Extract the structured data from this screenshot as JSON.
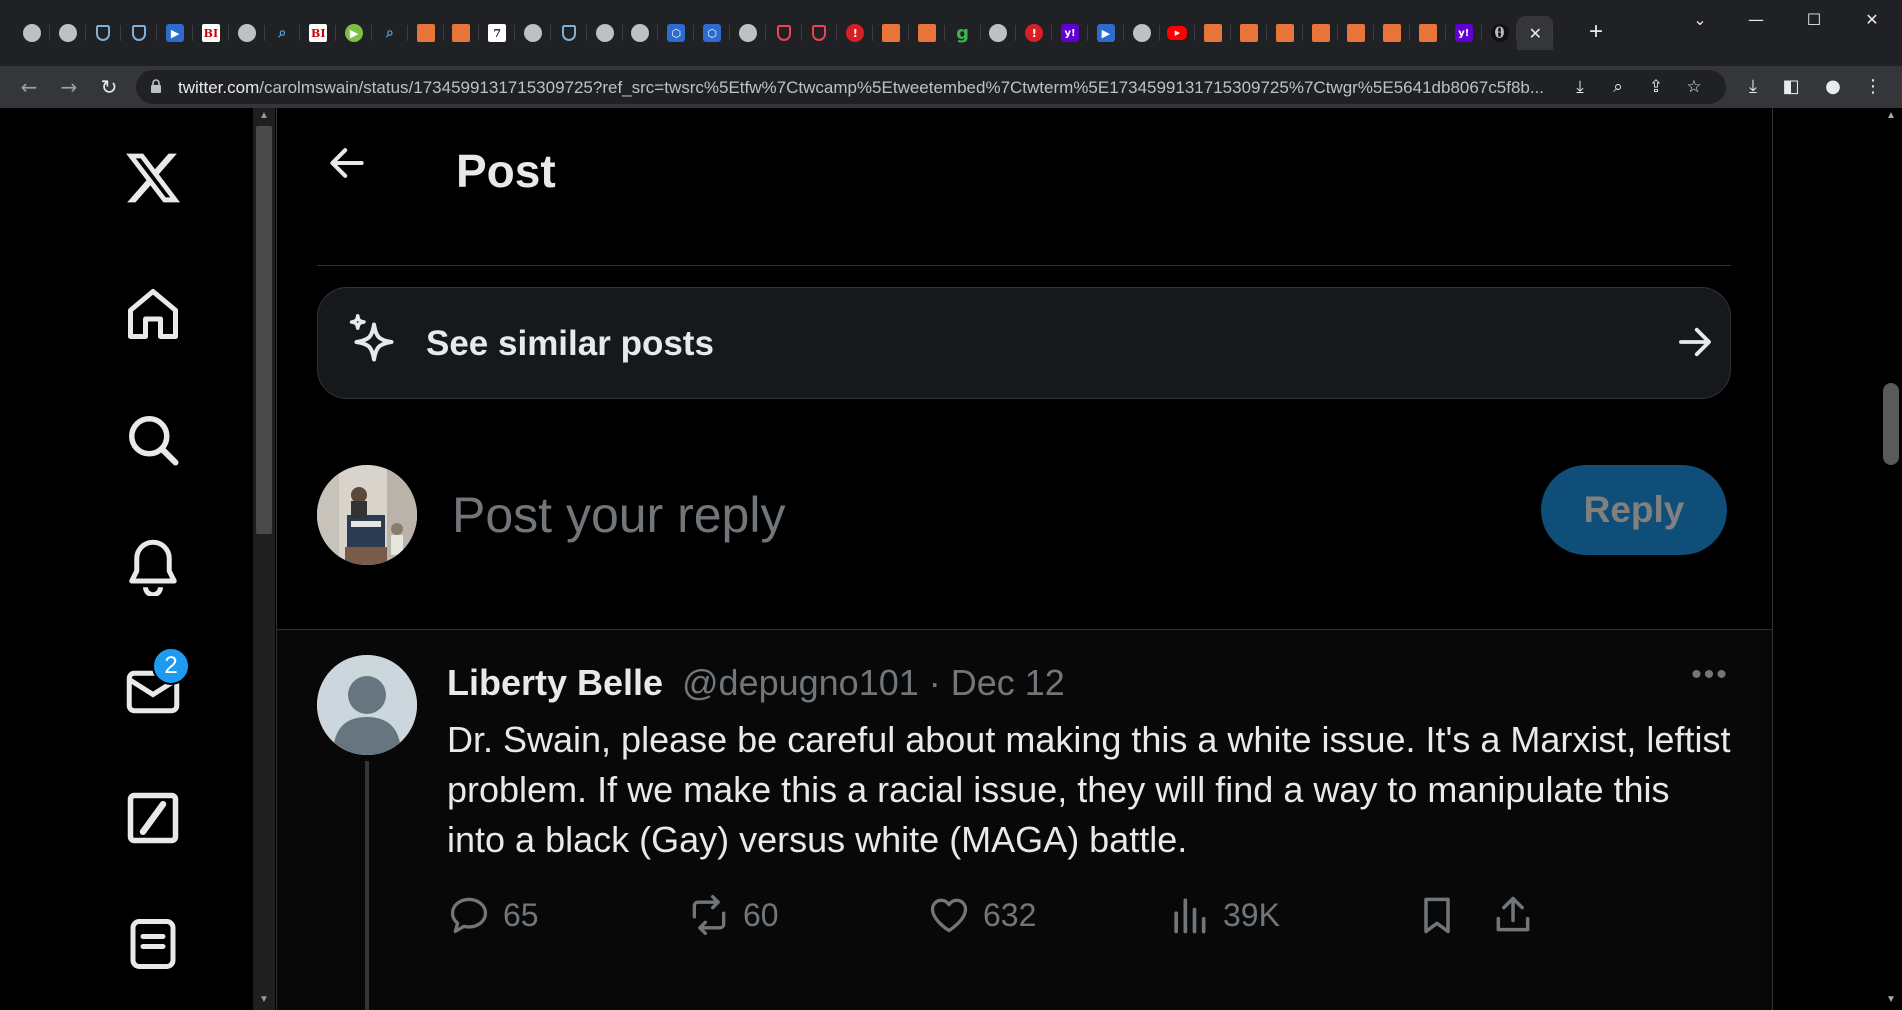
{
  "browser": {
    "tabs": [
      {
        "icon": "globe-favicon",
        "glyph": ""
      },
      {
        "icon": "globe-favicon",
        "glyph": ""
      },
      {
        "icon": "shield-favicon",
        "glyph": ""
      },
      {
        "icon": "shield-favicon",
        "glyph": ""
      },
      {
        "icon": "tag-favicon",
        "glyph": "▶"
      },
      {
        "icon": "bi-favicon",
        "glyph": "BI"
      },
      {
        "icon": "globe-favicon",
        "glyph": ""
      },
      {
        "icon": "search-favicon",
        "glyph": "⌕"
      },
      {
        "icon": "bi-favicon",
        "glyph": "BI"
      },
      {
        "icon": "play-favicon",
        "glyph": "▶"
      },
      {
        "icon": "search-favicon",
        "glyph": "⌕"
      },
      {
        "icon": "bookmark-favicon",
        "glyph": ""
      },
      {
        "icon": "bookmark-favicon",
        "glyph": ""
      },
      {
        "icon": "paper-favicon",
        "glyph": "7"
      },
      {
        "icon": "globe-favicon",
        "glyph": ""
      },
      {
        "icon": "shield-favicon",
        "glyph": ""
      },
      {
        "icon": "globe-favicon",
        "glyph": ""
      },
      {
        "icon": "globe-favicon",
        "glyph": ""
      },
      {
        "icon": "hex-favicon",
        "glyph": "⬡"
      },
      {
        "icon": "hex-favicon",
        "glyph": "⬡"
      },
      {
        "icon": "globe-favicon",
        "glyph": ""
      },
      {
        "icon": "pocket-favicon",
        "glyph": ""
      },
      {
        "icon": "pocket-favicon",
        "glyph": ""
      },
      {
        "icon": "red-favicon",
        "glyph": "!"
      },
      {
        "icon": "bookmark-favicon",
        "glyph": ""
      },
      {
        "icon": "bookmark-favicon",
        "glyph": ""
      },
      {
        "icon": "green-g-favicon",
        "glyph": "g"
      },
      {
        "icon": "globe-favicon",
        "glyph": ""
      },
      {
        "icon": "red-favicon",
        "glyph": "!"
      },
      {
        "icon": "yahoo-favicon",
        "glyph": "y!"
      },
      {
        "icon": "tag-favicon",
        "glyph": "▶"
      },
      {
        "icon": "globe-favicon",
        "glyph": ""
      },
      {
        "icon": "youtube-favicon",
        "glyph": "▶"
      },
      {
        "icon": "bookmark-favicon",
        "glyph": ""
      },
      {
        "icon": "bookmark-favicon",
        "glyph": ""
      },
      {
        "icon": "bookmark-favicon",
        "glyph": ""
      },
      {
        "icon": "bookmark-favicon",
        "glyph": ""
      },
      {
        "icon": "bookmark-favicon",
        "glyph": ""
      },
      {
        "icon": "bookmark-favicon",
        "glyph": ""
      },
      {
        "icon": "bookmark-favicon",
        "glyph": ""
      },
      {
        "icon": "yahoo-favicon",
        "glyph": "y!"
      },
      {
        "icon": "theta-favicon",
        "glyph": "θ"
      },
      {
        "icon": "close-icon",
        "glyph": "✕",
        "active": true
      }
    ],
    "url_host": "twitter.com",
    "url_rest": "/carolmswain/status/1734599131715309725?ref_src=twsrc%5Etfw%7Ctwcamp%5Etweetembed%7Ctwterm%5E1734599131715309725%7Ctwgr%5E5641db8067c5f8b..."
  },
  "header": {
    "title": "Post"
  },
  "similar": {
    "label": "See similar posts"
  },
  "composer": {
    "placeholder": "Post your reply",
    "reply_label": "Reply"
  },
  "nav": {
    "messages_badge": "2"
  },
  "reply_post": {
    "author": "Liberty Belle",
    "handle_date": "@depugno101 · Dec 12",
    "text": "Dr. Swain, please be careful about making this a white issue. It's a Marxist, leftist problem. If we make this a racial issue, they will find a way to manipulate this into a black (Gay) versus white (MAGA) battle.",
    "replies": "65",
    "reposts": "60",
    "likes": "632",
    "views": "39K"
  },
  "colors": {
    "accent": "#1d9bf0",
    "reply_button_bg": "#0f4e78",
    "text_primary": "#e7e9ea",
    "text_secondary": "#71767b"
  }
}
